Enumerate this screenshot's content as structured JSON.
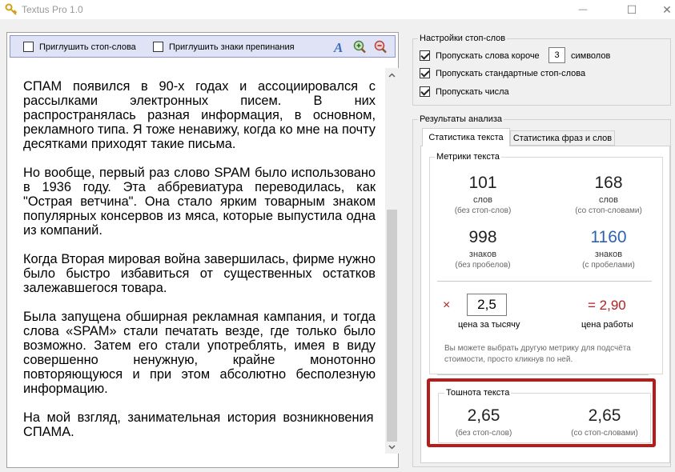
{
  "window": {
    "title": "Textus Pro 1.0",
    "min_glyph": "—",
    "max_glyph": "☐",
    "close_glyph": "✕"
  },
  "toolbar": {
    "mute_stopwords_label": "Приглушить стоп-слова",
    "mute_stopwords_checked": false,
    "mute_punct_label": "Приглушить знаки препинания",
    "mute_punct_checked": false
  },
  "text": {
    "paragraphs": [
      "СПАМ появился в 90-х годах и ассоциировался с рассылками электронных писем. В них распространялась разная информация, в основном, рекламного типа. Я тоже ненавижу, когда ко мне на почту десятками приходят такие письма.",
      "Но вообще, первый раз слово SPAM было использовано в 1936 году. Эта аббревиатура переводилась, как \"Острая ветчина\". Она стало ярким товарным знаком популярных консервов из мяса, которые выпустила одна из компаний.",
      "Когда Вторая мировая война завершилась, фирме нужно было быстро избавиться от существенных остатков залежавшегося товара.",
      "Была запущена обширная рекламная кампания, и тогда слова «SPAM» стали печатать везде, где только было возможно. Затем его стали употреблять, имея в виду совершенно ненужную, крайне монотонно повторяющуюся и при этом абсолютно бесполезную информацию.",
      "На мой взгляд, занимательная история возникновения СПАМА."
    ]
  },
  "stopwords": {
    "legend": "Настройки стоп-слов",
    "skip_short_label": "Пропускать слова короче",
    "skip_short_value": "3",
    "skip_short_suffix": "символов",
    "skip_standard_label": "Пропускать стандартные стоп-слова",
    "skip_numbers_label": "Пропускать числа"
  },
  "results": {
    "legend": "Результаты анализа",
    "tabs": [
      {
        "label": "Статистика текста",
        "active": true
      },
      {
        "label": "Статистика фраз и слов",
        "active": false
      }
    ],
    "metrics_legend": "Метрики текста",
    "metrics": [
      {
        "value": "101",
        "label": "слов",
        "sub": "(без стоп-слов)"
      },
      {
        "value": "168",
        "label": "слов",
        "sub": "(со стоп-словами)"
      },
      {
        "value": "998",
        "label": "знаков",
        "sub": "(без пробелов)"
      },
      {
        "value": "1160",
        "label": "знаков",
        "sub": "(с пробелами)"
      }
    ],
    "multiply_sign": "×",
    "price_value": "2,5",
    "price_label": "цена за тысячу",
    "work_price": "= 2,90",
    "work_price_label": "цена работы",
    "hint": "Вы можете выбрать другую метрику для подсчёта стоимости, просто кликнув по ней.",
    "nausea_legend": "Тошнота текста",
    "nausea": [
      {
        "value": "2,65",
        "sub": "(без стоп-слов)"
      },
      {
        "value": "2,65",
        "sub": "(со стоп-словами)"
      }
    ]
  },
  "colors": {
    "accent_blue": "#2f62b0",
    "price_red": "#b22222",
    "highlight_red": "#b71c1c"
  }
}
